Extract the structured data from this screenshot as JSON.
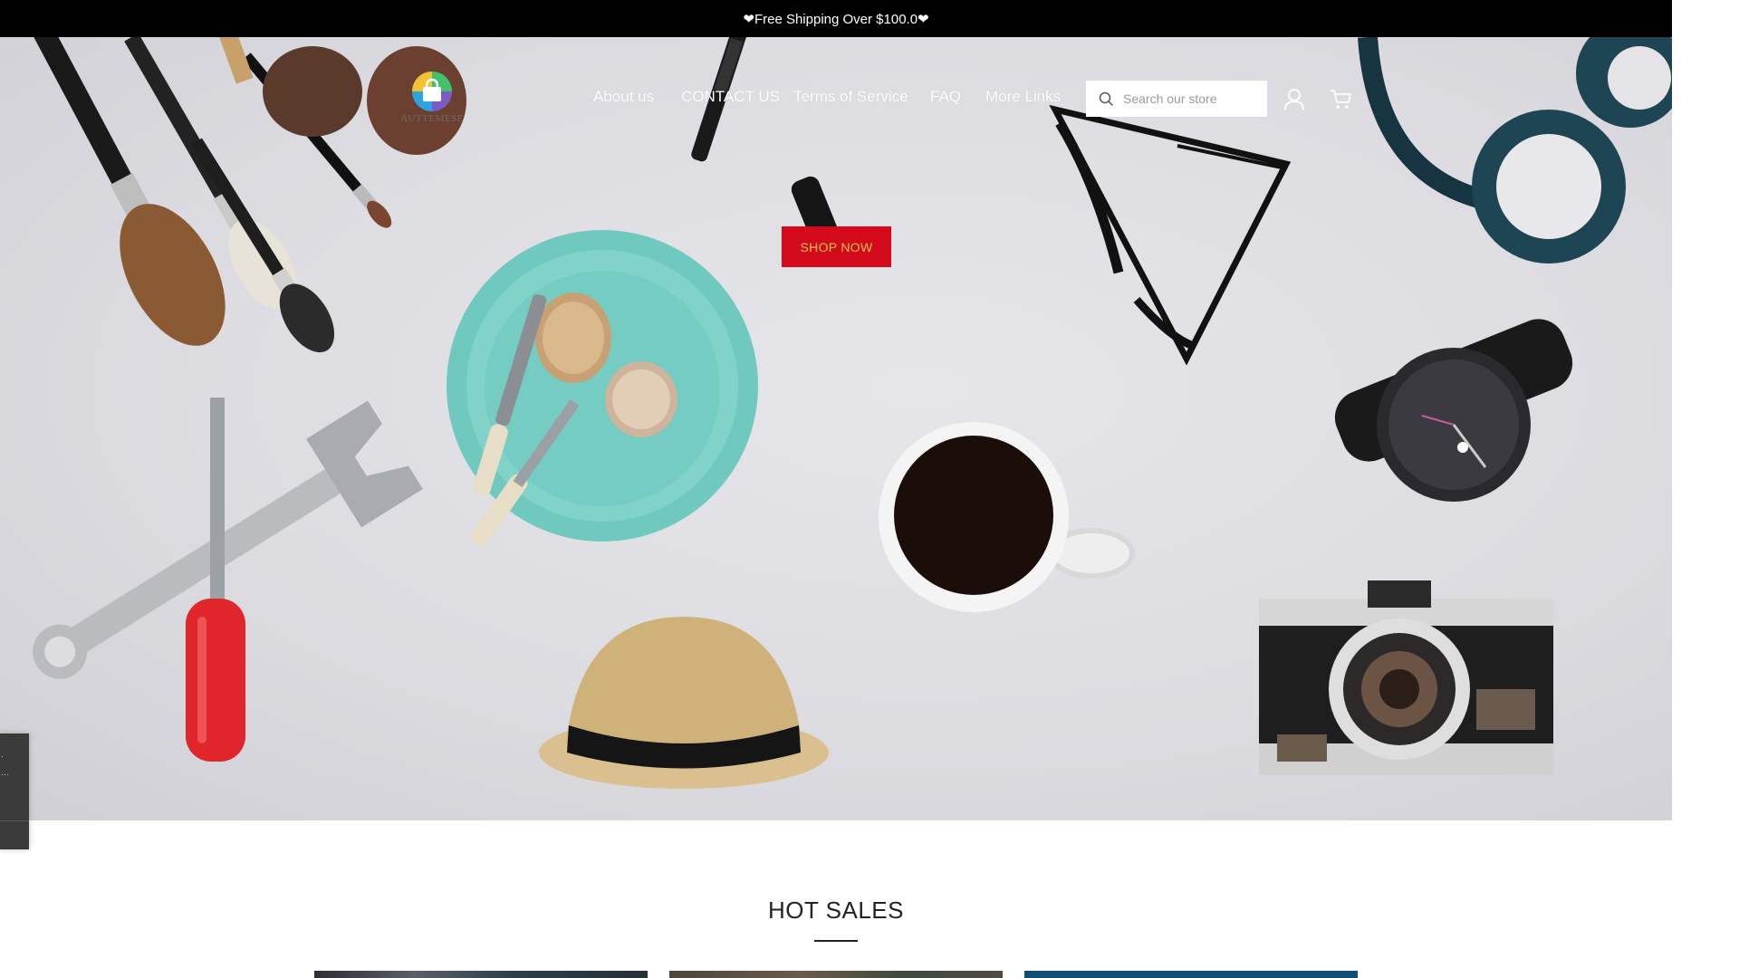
{
  "announcement": {
    "text": "❤Free Shipping Over $100.0❤"
  },
  "header": {
    "logo_text": "AUTTEMESE",
    "nav": [
      {
        "label": "About us"
      },
      {
        "label": "CONTACT US"
      },
      {
        "label": "Terms of Service"
      },
      {
        "label": "FAQ"
      },
      {
        "label": "More Links"
      }
    ],
    "search": {
      "placeholder": "Search our store"
    },
    "icons": [
      "search-icon",
      "user-icon",
      "cart-icon"
    ]
  },
  "hero": {
    "cta_label": "SHOP NOW",
    "cta_color": "#d20a1c",
    "cta_text_color": "#f3c04c"
  },
  "hot_sales": {
    "title": "HOT SALES"
  },
  "colors": {
    "announcement_bg": "#000000",
    "underline": "#222222",
    "card3": "#0f4d74"
  }
}
